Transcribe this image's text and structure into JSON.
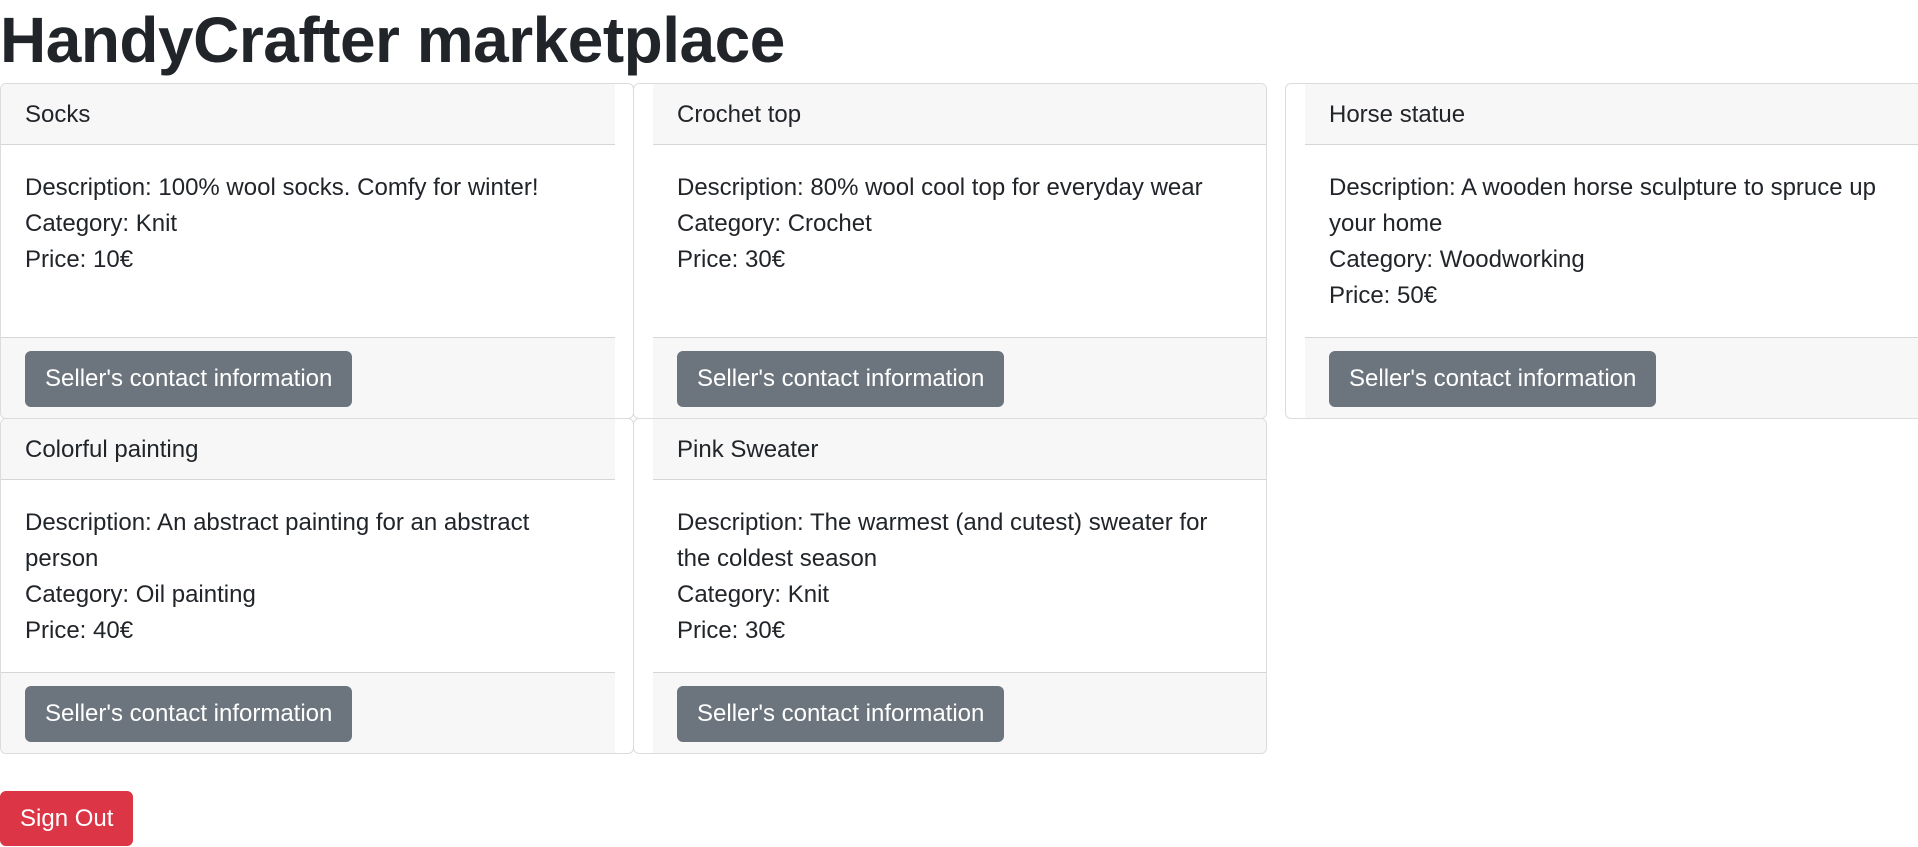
{
  "page": {
    "title": "HandyCrafter marketplace"
  },
  "products": [
    {
      "name": "Socks",
      "description": "Description: 100% wool socks. Comfy for winter!",
      "category": "Category: Knit",
      "price": "Price: 10€",
      "contact_label": "Seller's contact information"
    },
    {
      "name": "Crochet top",
      "description": "Description: 80% wool cool top for everyday wear",
      "category": "Category: Crochet",
      "price": "Price: 30€",
      "contact_label": "Seller's contact information"
    },
    {
      "name": "Horse statue",
      "description": "Description: A wooden horse sculpture to spruce up your home",
      "category": "Category: Woodworking",
      "price": "Price: 50€",
      "contact_label": "Seller's contact information"
    },
    {
      "name": "Colorful painting",
      "description": "Description: An abstract painting for an abstract person",
      "category": "Category: Oil painting",
      "price": "Price: 40€",
      "contact_label": "Seller's contact information"
    },
    {
      "name": "Pink Sweater",
      "description": "Description: The warmest (and cutest) sweater for the coldest season",
      "category": "Category: Knit",
      "price": "Price: 30€",
      "contact_label": "Seller's contact information"
    }
  ],
  "actions": {
    "sign_out_label": "Sign Out"
  },
  "colors": {
    "secondary_button": "#6c757d",
    "danger_button": "#dc3545",
    "card_header_bg": "#f7f7f7",
    "text": "#212529"
  }
}
